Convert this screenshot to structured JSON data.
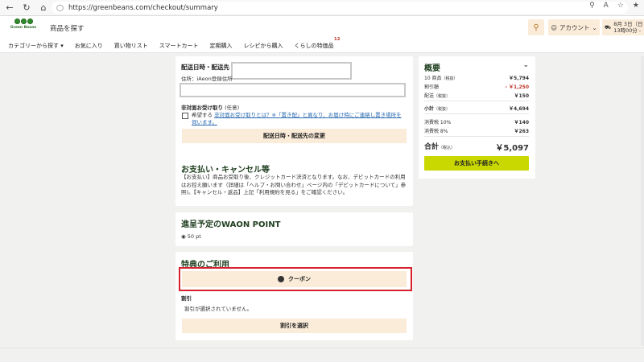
{
  "browser": {
    "url": "https://greenbeans.com/checkout/summary"
  },
  "header": {
    "logo_text": "Green Beans",
    "search_label": "商品を探す",
    "account_label": "アカウント",
    "delivery_line1": "8月 3日（日",
    "delivery_line2": "13時00分 -"
  },
  "nav": {
    "items": [
      {
        "label": "カテゴリーから探す ▾"
      },
      {
        "label": "お気に入り"
      },
      {
        "label": "買い物リスト"
      },
      {
        "label": "スマートカート"
      },
      {
        "label": "定期購入"
      },
      {
        "label": "レシピから購入"
      },
      {
        "label": "くらしの特価品"
      }
    ],
    "badge": "12"
  },
  "delivery": {
    "title": "配送日時・配送先",
    "address_label": "住所",
    "address_value": "iAeon登録住所",
    "unattended_label": "非対面お受け取り",
    "optional": "(任意)",
    "checkbox_text": "希望する",
    "link_text": "非対面お受け取りとは？※「置き配」と異なり、お届け時にご連絡し置き場所を伺います。",
    "change_button": "配送日時・配送先の変更"
  },
  "payment": {
    "title": "お支払い・キャンセル等",
    "description": "【お支払い】商品お受取り後、クレジットカード決済となります。なお、デビットカードの利用はお控え願います（詳細は「ヘルプ・お問い合わせ」ページ内の「デビットカードについて」参照)。【キャンセル・返品】上記「利用規約を見る」をご確認ください。"
  },
  "waon": {
    "title": "進呈予定のWAON POINT",
    "points": "50 pt"
  },
  "benefit": {
    "title": "特典のご利用",
    "coupon_button": "クーポン",
    "discount_label": "割引",
    "discount_note": "割引が選択されていません。",
    "select_discount_button": "割引を選択"
  },
  "summary": {
    "title": "概要",
    "rows": [
      {
        "label": "10 商品",
        "note": "（税抜）",
        "value": "￥5,794"
      },
      {
        "label": "割引額",
        "note": "",
        "value": "- ￥1,250"
      },
      {
        "label": "配送",
        "note": "（税抜）",
        "value": "￥150"
      }
    ],
    "subtotal": {
      "label": "小計",
      "note": "（税抜）",
      "value": "￥4,694"
    },
    "tax_rows": [
      {
        "label": "消費税 10%",
        "value": "￥140"
      },
      {
        "label": "消費税 8%",
        "value": "￥263"
      }
    ],
    "total": {
      "label": "合計",
      "note": "（税込）",
      "value": "￥5,097"
    },
    "pay_button": "お支払い手続きへ"
  },
  "colors": {
    "cream": "#fbecd9",
    "pay_button": "#c9d800",
    "highlight": "#d6202b",
    "discount_red": "#c0392b"
  }
}
